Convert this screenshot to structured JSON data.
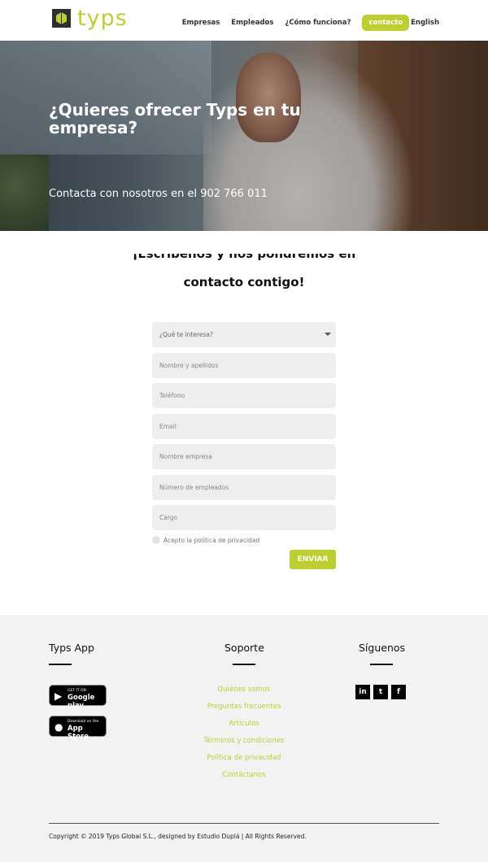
{
  "header": {
    "logo_text": "typs",
    "nav": {
      "empresas": "Empresas",
      "empleados": "Empleados",
      "como_funciona": "¿Cómo funciona?",
      "contacto": "contacto",
      "english": "English"
    }
  },
  "hero": {
    "title": "¿Quieres ofrecer Typs en tu empresa?",
    "subtitle": "Contacta con nosotros en el 902 766 011"
  },
  "form_section": {
    "heading_partial": "¡Escríbenos y nos pondremos en",
    "heading": "contacto contigo!",
    "select_placeholder": "¿Qué te interesa?",
    "fields": {
      "nombre": "Nombre y apellidos",
      "telefono": "Teléfono",
      "email": "Email",
      "empresa": "Nombre empresa",
      "empleados": "Número de empleados",
      "cargo": "Cargo"
    },
    "privacy_label": "Acepto la política de privacidad",
    "submit_label": "ENVIAR"
  },
  "footer": {
    "app": {
      "title": "Typs App",
      "google_small": "GET IT ON",
      "google_big": "Google play",
      "apple_small": "Download on the",
      "apple_big": "App Store"
    },
    "support": {
      "title": "Soporte",
      "links": [
        "Quiénes somos",
        "Preguntas frecuentes",
        "Artículos",
        "Términos y condiciones",
        "Política de privacidad",
        "Contáctanos"
      ]
    },
    "social": {
      "title": "Síguenos",
      "linkedin": "in",
      "twitter": "t",
      "facebook": "f"
    },
    "copyright": "Copyright © 2019 Typs Global S.L., designed by Estudio Duplá | All Rights Reserved."
  },
  "colors": {
    "accent": "#bccf2e",
    "footer_bg": "#f3f3f3",
    "field_bg": "#eeeeee"
  }
}
